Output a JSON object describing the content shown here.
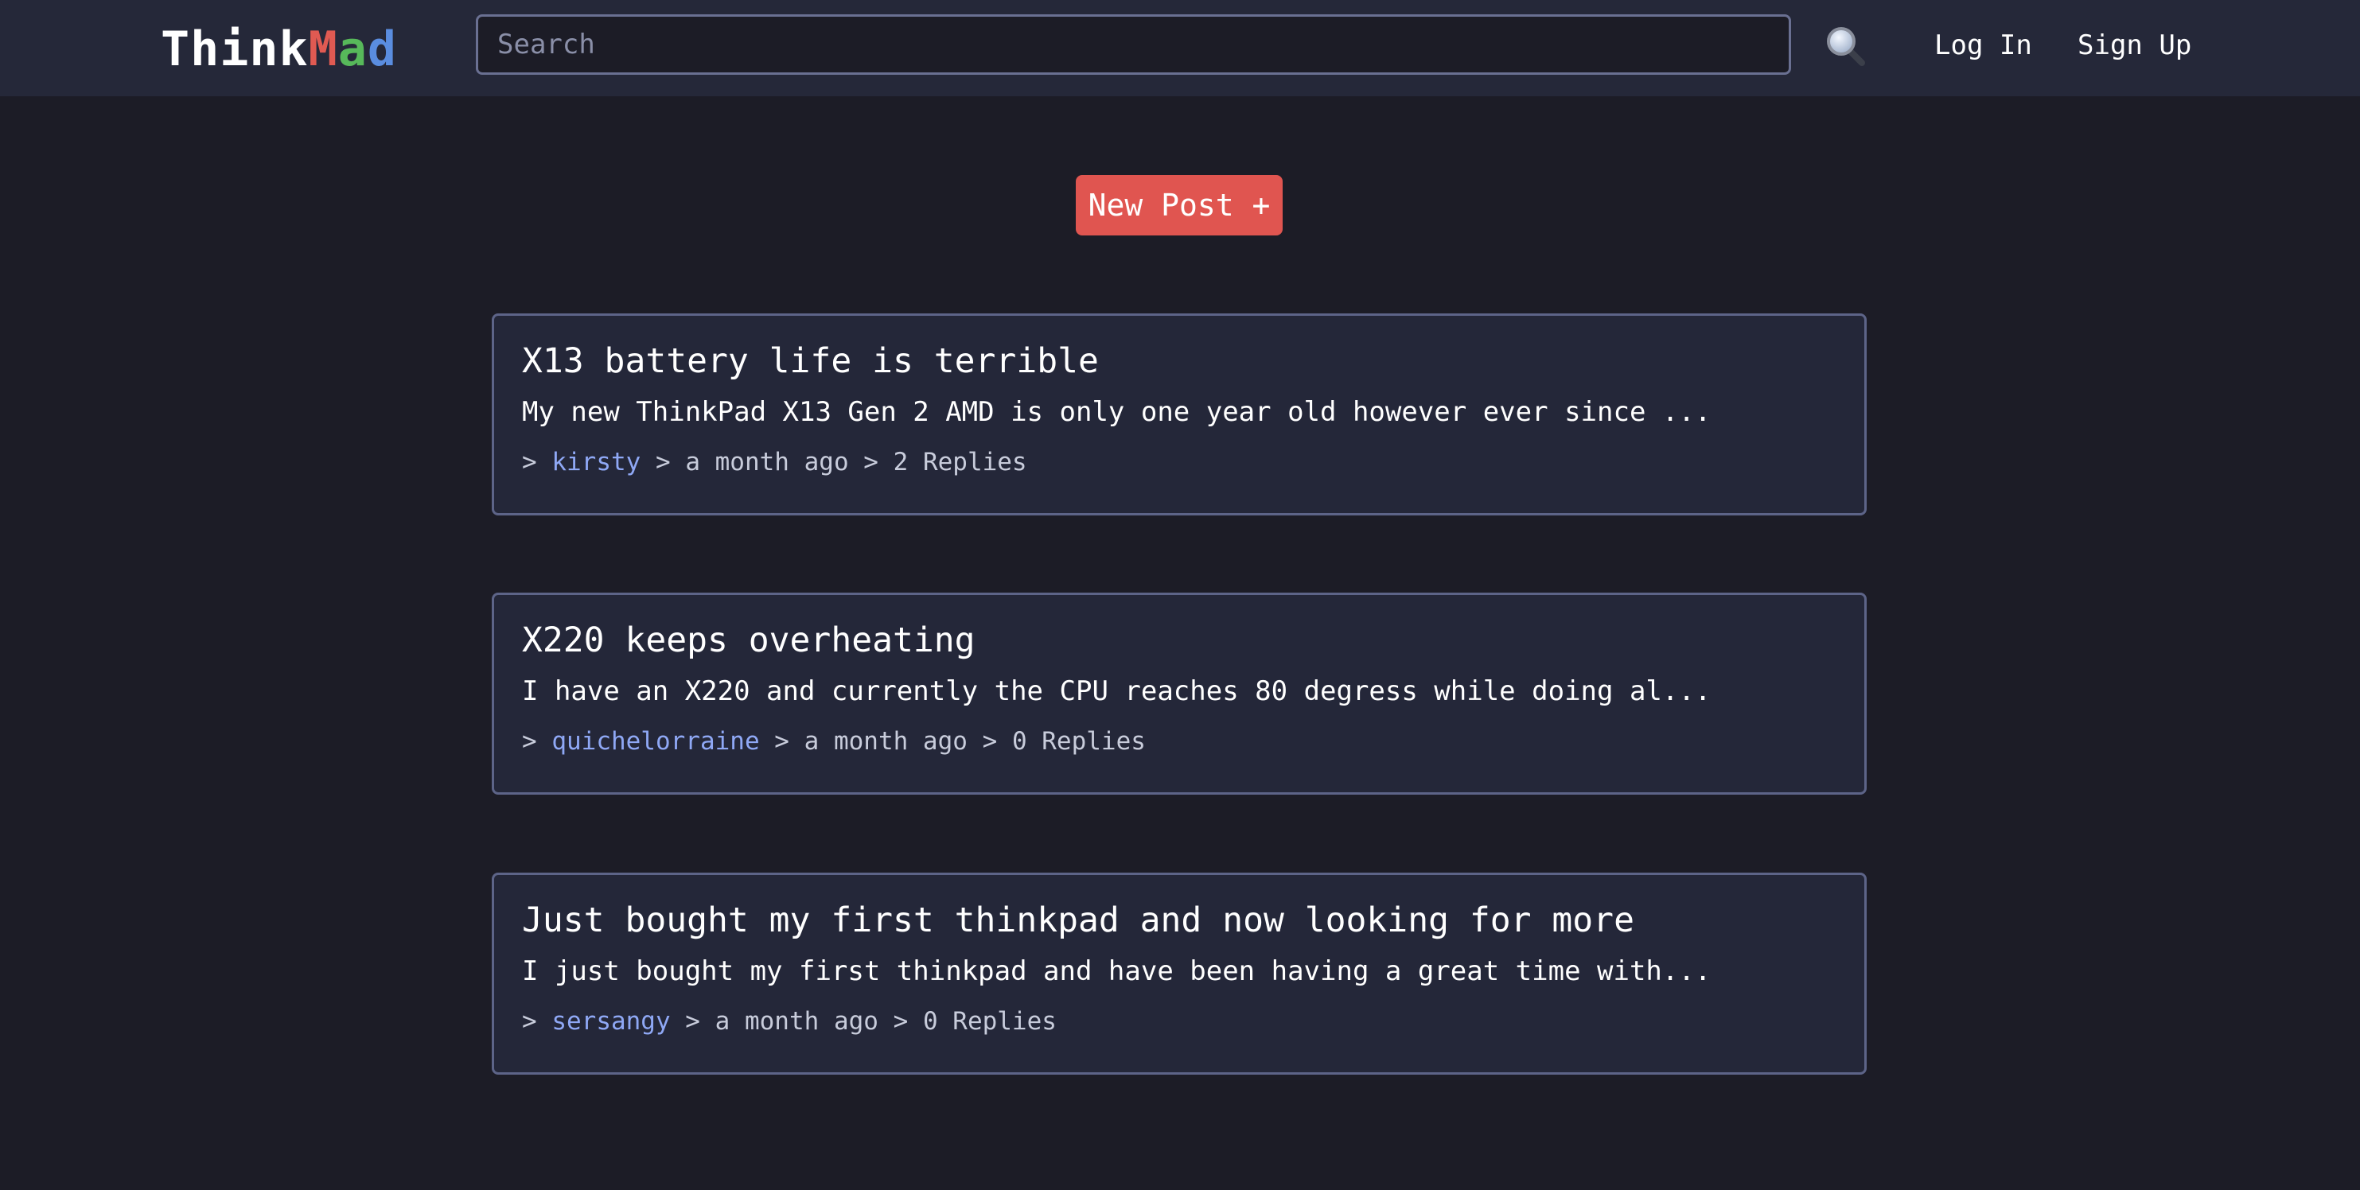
{
  "header": {
    "logo": {
      "think": "Think",
      "m": "M",
      "a": "a",
      "d": "d"
    },
    "search": {
      "placeholder": "Search"
    },
    "search_icon": "magnifying-glass",
    "login_label": "Log In",
    "signup_label": "Sign Up"
  },
  "new_post_label": "New Post +",
  "posts": [
    {
      "title": "X13 battery life is terrible",
      "excerpt": "My new ThinkPad X13 Gen 2 AMD is only one year old however ever since ...",
      "author": "kirsty",
      "time": "a month ago",
      "replies": "2 Replies"
    },
    {
      "title": "X220 keeps overheating",
      "excerpt": "I have an X220 and currently the CPU reaches 80 degress while doing al...",
      "author": "quichelorraine",
      "time": "a month ago",
      "replies": "0 Replies"
    },
    {
      "title": "Just bought my first thinkpad and now looking for more",
      "excerpt": "I just bought my first thinkpad and have been having a great time with...",
      "author": "sersangy",
      "time": "a month ago",
      "replies": "0 Replies"
    }
  ],
  "colors": {
    "background": "#1c1c26",
    "header": "#252839",
    "accent_red": "#e05550",
    "author_link": "#8fa8f5"
  }
}
